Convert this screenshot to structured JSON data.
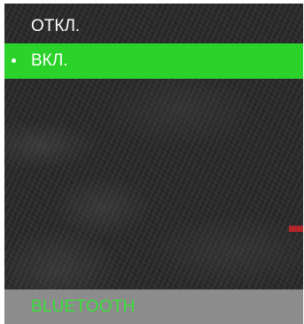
{
  "menu": {
    "items": [
      {
        "label": "ОТКЛ.",
        "selected": false
      },
      {
        "label": "ВКЛ.",
        "selected": true
      }
    ]
  },
  "footer": {
    "title": "BLUETOOTH"
  },
  "colors": {
    "selected_background": "#2ad22a",
    "footer_background": "#8c8c8c",
    "footer_text": "#38e238",
    "scroll_marker": "#b3262a",
    "menu_text": "#ffffff"
  },
  "icons": {
    "selection_indicator": "bullet-icon"
  }
}
